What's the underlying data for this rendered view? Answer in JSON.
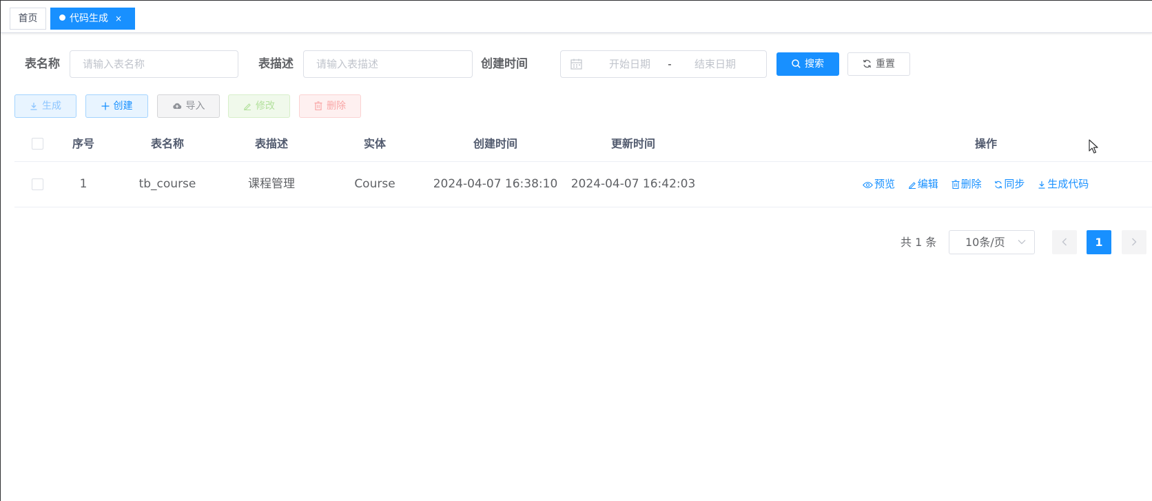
{
  "tags": [
    {
      "label": "首页"
    },
    {
      "label": "代码生成",
      "close": "×"
    }
  ],
  "search": {
    "table_name_label": "表名称",
    "table_name_placeholder": "请输入表名称",
    "table_desc_label": "表描述",
    "table_desc_placeholder": "请输入表描述",
    "create_time_label": "创建时间",
    "start_placeholder": "开始日期",
    "range_separator": "-",
    "end_placeholder": "结束日期",
    "search_button": "搜索",
    "reset_button": "重置"
  },
  "toolbar": {
    "generate": "生成",
    "create": "创建",
    "import": "导入",
    "edit": "修改",
    "delete": "删除"
  },
  "table": {
    "columns": [
      "序号",
      "表名称",
      "表描述",
      "实体",
      "创建时间",
      "更新时间",
      "操作"
    ],
    "rows": [
      {
        "index": "1",
        "table_name": "tb_course",
        "table_desc": "课程管理",
        "entity": "Course",
        "create_time": "2024-04-07 16:38:10",
        "update_time": "2024-04-07 16:42:03",
        "actions": [
          "预览",
          "编辑",
          "删除",
          "同步",
          "生成代码"
        ]
      }
    ]
  },
  "pagination": {
    "total": "共 1 条",
    "page_size": "10条/页",
    "current_page": "1"
  },
  "colors": {
    "primary": "#1890ff",
    "text": "#606266",
    "border": "#dcdfe6"
  }
}
